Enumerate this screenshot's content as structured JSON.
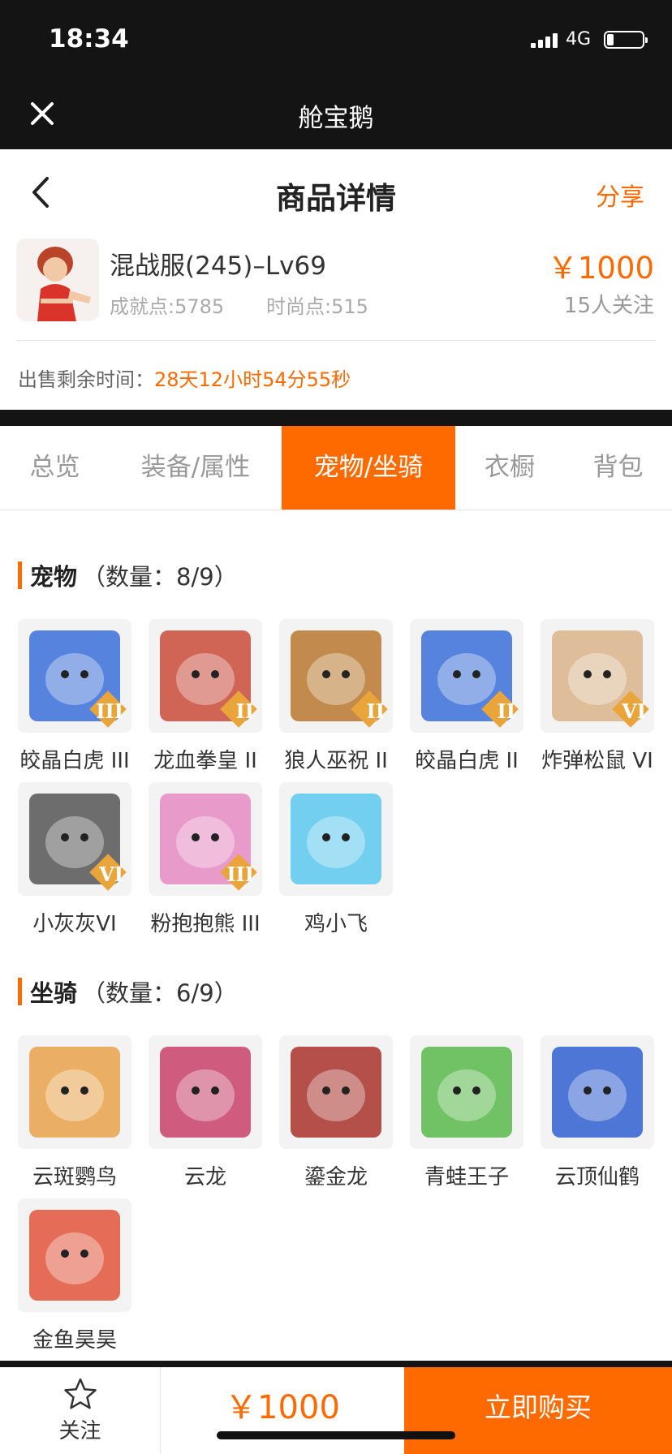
{
  "status": {
    "time": "18:34",
    "network": "4G",
    "battery_level": 0.2
  },
  "app": {
    "title": "舱宝鹅"
  },
  "header": {
    "title": "商品详情",
    "share": "分享"
  },
  "product": {
    "name": "混战服(245)–Lv69",
    "achievement": "成就点:5785",
    "fashion": "时尚点:515",
    "price": "￥1000",
    "followers": "15人关注",
    "sale_time_label": "出售剩余时间：",
    "sale_time_value": "28天12小时54分55秒"
  },
  "tabs": [
    {
      "label": "总览",
      "active": false
    },
    {
      "label": "装备/属性",
      "active": false
    },
    {
      "label": "宠物/坐骑",
      "active": true
    },
    {
      "label": "衣橱",
      "active": false
    },
    {
      "label": "背包",
      "active": false
    }
  ],
  "pets": {
    "title": "宠物",
    "count": "（数量：8/9）",
    "items": [
      {
        "name": "皎晶白虎 III",
        "badge": "III",
        "color": "#3a6fd8"
      },
      {
        "name": "龙血拳皇 II",
        "badge": "II",
        "color": "#c94b3a"
      },
      {
        "name": "狼人巫祝 II",
        "badge": "II",
        "color": "#b8772e"
      },
      {
        "name": "皎晶白虎 II",
        "badge": "II",
        "color": "#3a6fd8"
      },
      {
        "name": "炸弹松鼠 VI",
        "badge": "VI",
        "color": "#d9b48a"
      },
      {
        "name": "小灰灰VI",
        "badge": "VI",
        "color": "#555555"
      },
      {
        "name": "粉抱抱熊 III",
        "badge": "III",
        "color": "#e58ac3"
      },
      {
        "name": "鸡小飞",
        "badge": "",
        "color": "#5cc8ee"
      }
    ]
  },
  "mounts": {
    "title": "坐骑",
    "count": "（数量：6/9）",
    "items": [
      {
        "name": "云斑鹦鸟",
        "color": "#e8a24a"
      },
      {
        "name": "云龙",
        "color": "#c8406a"
      },
      {
        "name": "鎏金龙",
        "color": "#a8322a"
      },
      {
        "name": "青蛙王子",
        "color": "#58b84a"
      },
      {
        "name": "云顶仙鹤",
        "color": "#2f5fd0"
      },
      {
        "name": "金鱼昊昊",
        "color": "#e2553c"
      }
    ]
  },
  "bottom": {
    "follow": "关注",
    "price": "￥1000",
    "buy": "立即购买"
  }
}
